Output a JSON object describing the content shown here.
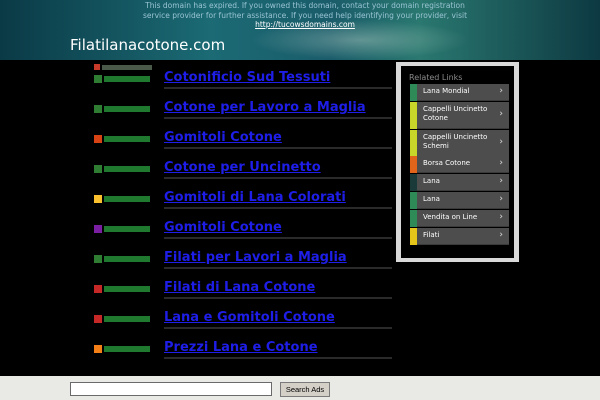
{
  "notice": {
    "text": "This domain has expired. If you owned this domain, contact your domain registration service provider for further assistance. If you need help identifying your provider, visit",
    "link": "http://tucowsdomains.com"
  },
  "site_title": "Filatilanacotone.com",
  "results": [
    {
      "link": "Cotonificio Sud Tessuti",
      "icon_color": "#2e7d32"
    },
    {
      "link": "Cotone per Lavoro a Maglia",
      "icon_color": "#2e7d32"
    },
    {
      "link": "Gomitoli Cotone",
      "icon_color": "#d84315"
    },
    {
      "link": "Cotone per Uncinetto",
      "icon_color": "#2e7d32"
    },
    {
      "link": "Gomitoli di Lana Colorati",
      "icon_color": "#fbc02d"
    },
    {
      "link": "Gomitoli Cotone",
      "icon_color": "#7b1fa2"
    },
    {
      "link": "Filati per Lavori a Maglia",
      "icon_color": "#2e7d32"
    },
    {
      "link": "Filati di Lana Cotone",
      "icon_color": "#c62828"
    },
    {
      "link": "Lana e Gomitoli Cotone",
      "icon_color": "#c62828"
    },
    {
      "link": "Prezzi Lana e Cotone",
      "icon_color": "#f57f17"
    }
  ],
  "panel": {
    "title": "Related Links",
    "items": [
      {
        "label": "Lana Mondial",
        "color": "#2e8b57"
      },
      {
        "label": "Cappelli Uncinetto Cotone",
        "color": "#c8d62a"
      },
      {
        "label": "Cappelli Uncinetto Schemi",
        "color": "#c8d62a"
      },
      {
        "label": "Borsa Cotone",
        "color": "#e0651a"
      },
      {
        "label": "Lana",
        "color": "#1a3a3a"
      },
      {
        "label": "Lana",
        "color": "#2e8b57"
      },
      {
        "label": "Vendita on Line",
        "color": "#2e8b57"
      },
      {
        "label": "Filati",
        "color": "#e6c51a"
      }
    ],
    "chevron": "›"
  },
  "search": {
    "placeholder": "",
    "button_label": "Search Ads"
  }
}
